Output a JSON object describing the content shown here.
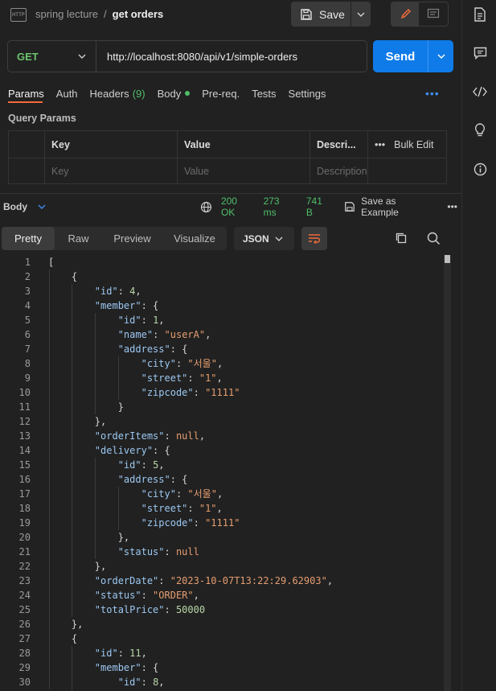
{
  "header": {
    "breadcrumb_collection": "spring lecture",
    "breadcrumb_separator": "/",
    "breadcrumb_request": "get orders",
    "save_label": "Save",
    "app_icon_text": "HTTP"
  },
  "request": {
    "method": "GET",
    "url": "http://localhost:8080/api/v1/simple-orders",
    "send_label": "Send"
  },
  "tabs": {
    "params": "Params",
    "auth": "Auth",
    "headers": "Headers",
    "headers_count": "(9)",
    "body": "Body",
    "prereq": "Pre-req.",
    "tests": "Tests",
    "settings": "Settings",
    "more": "•••"
  },
  "params": {
    "title": "Query Params",
    "col_key": "Key",
    "col_value": "Value",
    "col_desc": "Descri...",
    "bulk_more": "•••",
    "bulk_edit": "Bulk Edit",
    "ph_key": "Key",
    "ph_value": "Value",
    "ph_desc": "Description"
  },
  "response": {
    "body_label": "Body",
    "status": "200 OK",
    "time": "273 ms",
    "size": "741 B",
    "save_example": "Save as Example",
    "more": "•••",
    "view_tabs": [
      "Pretty",
      "Raw",
      "Preview",
      "Visualize"
    ],
    "format": "JSON"
  },
  "code_lines": [
    "[",
    "    {",
    "        \"id\": 4,",
    "        \"member\": {",
    "            \"id\": 1,",
    "            \"name\": \"userA\",",
    "            \"address\": {",
    "                \"city\": \"서울\",",
    "                \"street\": \"1\",",
    "                \"zipcode\": \"1111\"",
    "            }",
    "        },",
    "        \"orderItems\": null,",
    "        \"delivery\": {",
    "            \"id\": 5,",
    "            \"address\": {",
    "                \"city\": \"서울\",",
    "                \"street\": \"1\",",
    "                \"zipcode\": \"1111\"",
    "            },",
    "            \"status\": null",
    "        },",
    "        \"orderDate\": \"2023-10-07T13:22:29.62903\",",
    "        \"status\": \"ORDER\",",
    "        \"totalPrice\": 50000",
    "    },",
    "    {",
    "        \"id\": 11,",
    "        \"member\": {",
    "            \"id\": 8,"
  ],
  "colors": {
    "accent": "#f26b3a",
    "send": "#0f7be8",
    "status_green": "#4fbe6a",
    "json_key": "#9cc8f2",
    "json_string": "#e69e70"
  }
}
